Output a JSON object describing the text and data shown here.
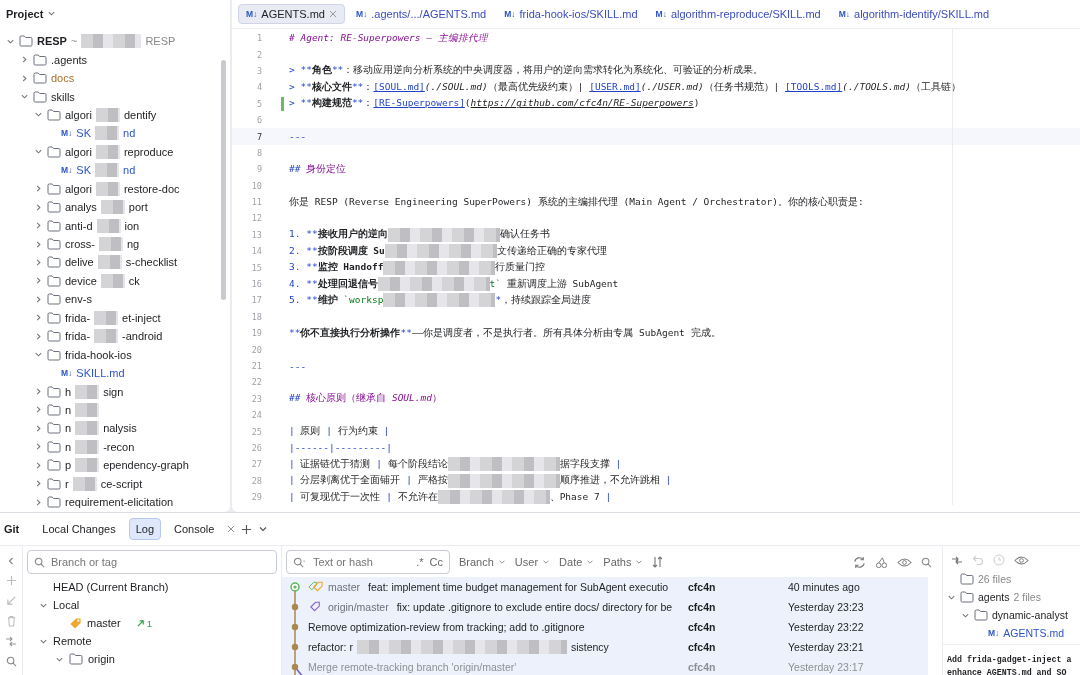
{
  "project": {
    "title": "Project",
    "tree": [
      {
        "kind": "folder",
        "expanded": true,
        "label_parts": [
          "RESP"
        ],
        "path_parts": [
          "~",
          "RESP"
        ],
        "children": [
          {
            "kind": "folder",
            "expanded": false,
            "ignored": false,
            "label_parts": [
              ".agents"
            ]
          },
          {
            "kind": "folder",
            "expanded": false,
            "ignored": true,
            "label_parts": [
              "docs"
            ]
          },
          {
            "kind": "folder",
            "expanded": true,
            "ignored": false,
            "label_parts": [
              "skills"
            ],
            "children": [
              {
                "kind": "folder",
                "expanded": true,
                "label_parts": [
                  "algori",
                  "dentify"
                ],
                "children": [
                  {
                    "kind": "file",
                    "badge": "M↓",
                    "label_parts": [
                      "SK",
                      "nd"
                    ]
                  }
                ]
              },
              {
                "kind": "folder",
                "expanded": true,
                "label_parts": [
                  "algori",
                  "reproduce"
                ],
                "children": [
                  {
                    "kind": "file",
                    "badge": "M↓",
                    "label_parts": [
                      "SK",
                      "nd"
                    ]
                  }
                ]
              },
              {
                "kind": "folder",
                "expanded": false,
                "label_parts": [
                  "algori",
                  "restore-doc"
                ]
              },
              {
                "kind": "folder",
                "expanded": false,
                "label_parts": [
                  "analys",
                  "port"
                ]
              },
              {
                "kind": "folder",
                "expanded": false,
                "label_parts": [
                  "anti-d",
                  "ion"
                ]
              },
              {
                "kind": "folder",
                "expanded": false,
                "label_parts": [
                  "cross-",
                  "ng"
                ]
              },
              {
                "kind": "folder",
                "expanded": false,
                "label_parts": [
                  "delive",
                  "s-checklist"
                ]
              },
              {
                "kind": "folder",
                "expanded": false,
                "label_parts": [
                  "device",
                  "ck"
                ]
              },
              {
                "kind": "folder",
                "expanded": false,
                "label_parts": [
                  "env-s"
                ]
              },
              {
                "kind": "folder",
                "expanded": false,
                "label_parts": [
                  "frida-",
                  "et-inject"
                ]
              },
              {
                "kind": "folder",
                "expanded": false,
                "label_parts": [
                  "frida-",
                  "-android"
                ]
              },
              {
                "kind": "folder",
                "expanded": true,
                "label_parts": [
                  "frida-hook-ios"
                ],
                "children": [
                  {
                    "kind": "file",
                    "badge": "M↓",
                    "label_parts": [
                      "SKILL.md"
                    ]
                  }
                ]
              },
              {
                "kind": "folder",
                "expanded": false,
                "label_parts": [
                  "h",
                  "sign"
                ]
              },
              {
                "kind": "folder",
                "expanded": false,
                "label_parts": [
                  "n"
                ],
                "trailing_redaction": true
              },
              {
                "kind": "folder",
                "expanded": false,
                "label_parts": [
                  "n",
                  "nalysis"
                ]
              },
              {
                "kind": "folder",
                "expanded": false,
                "label_parts": [
                  "n",
                  "-recon"
                ]
              },
              {
                "kind": "folder",
                "expanded": false,
                "label_parts": [
                  "p",
                  "ependency-graph"
                ]
              },
              {
                "kind": "folder",
                "expanded": false,
                "label_parts": [
                  "r",
                  "ce-script"
                ]
              },
              {
                "kind": "folder",
                "expanded": false,
                "label_parts": [
                  "requirement-elicitation"
                ]
              }
            ]
          }
        ]
      }
    ]
  },
  "editor": {
    "tabs": [
      {
        "badge": "M↓",
        "label": "AGENTS.md",
        "selected": true
      },
      {
        "badge": "M↓",
        "label": ".agents/.../AGENTS.md",
        "selected": false
      },
      {
        "badge": "M↓",
        "label": "frida-hook-ios/SKILL.md",
        "selected": false
      },
      {
        "badge": "M↓",
        "label": "algorithm-reproduce/SKILL.md",
        "selected": false
      },
      {
        "badge": "M↓",
        "label": "algorithm-identify/SKILL.md",
        "selected": false
      }
    ],
    "lines": [
      {
        "num": "1",
        "current": false,
        "changed": false,
        "segments": [
          {
            "kind": "heading_italic",
            "text": "# Agent: RE-Superpowers — 主编排代理"
          }
        ]
      },
      {
        "num": "2",
        "current": false,
        "changed": false
      },
      {
        "num": "3",
        "current": false,
        "changed": false,
        "segments": [
          {
            "kind": "mark",
            "text": "> **"
          },
          {
            "kind": "bold",
            "text": "角色"
          },
          {
            "kind": "mark",
            "text": "**"
          },
          {
            "kind": "text",
            "text": "：移动应用逆向分析系统的中央调度器，将用户的逆向需求转化为系统化、可验证的分析成果。"
          }
        ]
      },
      {
        "num": "4",
        "current": false,
        "changed": false,
        "segments": [
          {
            "kind": "mark",
            "text": "> **"
          },
          {
            "kind": "bold",
            "text": "核心文件"
          },
          {
            "kind": "mark",
            "text": "**"
          },
          {
            "kind": "text",
            "text": "："
          },
          {
            "kind": "link",
            "text": "[SOUL.md]"
          },
          {
            "kind": "path",
            "text": "(./SOUL.md)"
          },
          {
            "kind": "text",
            "text": "（最高优先级约束）| "
          },
          {
            "kind": "link",
            "text": "[USER.md]"
          },
          {
            "kind": "path",
            "text": "(./USER.md)"
          },
          {
            "kind": "text",
            "text": "（任务书规范）| "
          },
          {
            "kind": "link",
            "text": "[TOOLS.md]"
          },
          {
            "kind": "path",
            "text": "(./TOOLS.md)"
          },
          {
            "kind": "text",
            "text": "（工具链）"
          }
        ]
      },
      {
        "num": "5",
        "current": false,
        "changed": true,
        "segments": [
          {
            "kind": "mark",
            "text": "> **"
          },
          {
            "kind": "bold",
            "text": "构建规范"
          },
          {
            "kind": "mark",
            "text": "**"
          },
          {
            "kind": "text",
            "text": "："
          },
          {
            "kind": "link",
            "text": "[RE-Superpowers]"
          },
          {
            "kind": "text",
            "text": "("
          },
          {
            "kind": "url",
            "text": "https://github.com/cfc4n/RE-Superpowers"
          },
          {
            "kind": "text",
            "text": ")"
          }
        ]
      },
      {
        "num": "6",
        "current": false,
        "changed": false
      },
      {
        "num": "7",
        "current": true,
        "changed": false,
        "segments": [
          {
            "kind": "mark",
            "text": "---"
          }
        ]
      },
      {
        "num": "8",
        "current": false,
        "changed": false
      },
      {
        "num": "9",
        "current": false,
        "changed": false,
        "segments": [
          {
            "kind": "mark",
            "text": "## "
          },
          {
            "kind": "heading",
            "text": "身份定位"
          }
        ]
      },
      {
        "num": "10",
        "current": false,
        "changed": false
      },
      {
        "num": "11",
        "current": false,
        "changed": false,
        "segments": [
          {
            "kind": "text",
            "text": "你是 RESP (Reverse Engineering SuperPowers) 系统的主编排代理 (Main Agent / Orchestrator)。你的核心职责是:"
          }
        ]
      },
      {
        "num": "12",
        "current": false,
        "changed": false
      },
      {
        "num": "13",
        "current": false,
        "changed": false,
        "segments": [
          {
            "kind": "mark",
            "text": "1. **"
          },
          {
            "kind": "bold",
            "text": "接收用户的逆向"
          },
          {
            "kind": "redacted"
          },
          {
            "kind": "text",
            "text": "确认任务书"
          }
        ]
      },
      {
        "num": "14",
        "current": false,
        "changed": false,
        "segments": [
          {
            "kind": "mark",
            "text": "2. **"
          },
          {
            "kind": "bold",
            "text": "按阶段调度 Su"
          },
          {
            "kind": "redacted"
          },
          {
            "kind": "text",
            "text": "文传递给正确的专家代理"
          }
        ]
      },
      {
        "num": "15",
        "current": false,
        "changed": false,
        "segments": [
          {
            "kind": "mark",
            "text": "3. **"
          },
          {
            "kind": "bold",
            "text": "监控 Handoff"
          },
          {
            "kind": "redacted"
          },
          {
            "kind": "text",
            "text": "行质量门控"
          }
        ]
      },
      {
        "num": "16",
        "current": false,
        "changed": false,
        "segments": [
          {
            "kind": "mark",
            "text": "4. **"
          },
          {
            "kind": "bold",
            "text": "处理回退信号"
          },
          {
            "kind": "redacted"
          },
          {
            "kind": "code",
            "text": "t`"
          },
          {
            "kind": "text",
            "text": " 重新调度上游 SubAgent"
          }
        ]
      },
      {
        "num": "17",
        "current": false,
        "changed": false,
        "segments": [
          {
            "kind": "mark",
            "text": "5. **"
          },
          {
            "kind": "bold",
            "text": "维护 "
          },
          {
            "kind": "code",
            "text": "`worksp"
          },
          {
            "kind": "redacted"
          },
          {
            "kind": "mark",
            "text": "*"
          },
          {
            "kind": "text",
            "text": "，持续跟踪全局进度"
          }
        ]
      },
      {
        "num": "18",
        "current": false,
        "changed": false
      },
      {
        "num": "19",
        "current": false,
        "changed": false,
        "segments": [
          {
            "kind": "mark",
            "text": "**"
          },
          {
            "kind": "bold",
            "text": "你不直接执行分析操作"
          },
          {
            "kind": "mark",
            "text": "**"
          },
          {
            "kind": "text",
            "text": "——你是调度者，不是执行者。所有具体分析由专属 SubAgent 完成。"
          }
        ]
      },
      {
        "num": "20",
        "current": false,
        "changed": false
      },
      {
        "num": "21",
        "current": false,
        "changed": false,
        "segments": [
          {
            "kind": "mark",
            "text": "---"
          }
        ]
      },
      {
        "num": "22",
        "current": false,
        "changed": false
      },
      {
        "num": "23",
        "current": false,
        "changed": false,
        "segments": [
          {
            "kind": "mark",
            "text": "## "
          },
          {
            "kind": "heading",
            "text": "核心原则（继承自 "
          },
          {
            "kind": "heading_italic",
            "text": "SOUL.md"
          },
          {
            "kind": "heading",
            "text": "）"
          }
        ]
      },
      {
        "num": "24",
        "current": false,
        "changed": false
      },
      {
        "num": "25",
        "current": false,
        "changed": false,
        "segments": [
          {
            "kind": "mark",
            "text": "| "
          },
          {
            "kind": "text",
            "text": "原则 "
          },
          {
            "kind": "mark",
            "text": "| "
          },
          {
            "kind": "text",
            "text": "行为约束 "
          },
          {
            "kind": "mark",
            "text": "|"
          }
        ]
      },
      {
        "num": "26",
        "current": false,
        "changed": false,
        "segments": [
          {
            "kind": "mark",
            "text": "|------|---------|"
          }
        ]
      },
      {
        "num": "27",
        "current": false,
        "changed": false,
        "segments": [
          {
            "kind": "mark",
            "text": "| "
          },
          {
            "kind": "text",
            "text": "证据链优于猜测 "
          },
          {
            "kind": "mark",
            "text": "| "
          },
          {
            "kind": "text",
            "text": "每个阶段结论"
          },
          {
            "kind": "redacted"
          },
          {
            "kind": "text",
            "text": "据字段支撑 "
          },
          {
            "kind": "mark",
            "text": "|"
          }
        ]
      },
      {
        "num": "28",
        "current": false,
        "changed": false,
        "segments": [
          {
            "kind": "mark",
            "text": "| "
          },
          {
            "kind": "text",
            "text": "分层剥离优于全面铺开 "
          },
          {
            "kind": "mark",
            "text": "| "
          },
          {
            "kind": "text",
            "text": "严格按"
          },
          {
            "kind": "redacted"
          },
          {
            "kind": "text",
            "text": "顺序推进，不允许跳相 "
          },
          {
            "kind": "mark",
            "text": "|"
          }
        ]
      },
      {
        "num": "29",
        "current": false,
        "changed": false,
        "segments": [
          {
            "kind": "mark",
            "text": "| "
          },
          {
            "kind": "text",
            "text": "可复现优于一次性 "
          },
          {
            "kind": "mark",
            "text": "| "
          },
          {
            "kind": "text",
            "text": "不允许在"
          },
          {
            "kind": "redacted"
          },
          {
            "kind": "text",
            "text": "、Phase 7 "
          },
          {
            "kind": "mark",
            "text": "|"
          }
        ]
      }
    ]
  },
  "git": {
    "title": "Git",
    "tabs": [
      {
        "label": "Local Changes",
        "selected": false,
        "closable": false
      },
      {
        "label": "Log",
        "selected": true,
        "closable": false
      },
      {
        "label": "Console",
        "selected": false,
        "closable": true
      }
    ],
    "branches": {
      "search": {
        "placeholder": "Branch or tag"
      },
      "items": [
        {
          "kind": "head",
          "label": "HEAD (Current Branch)"
        },
        {
          "kind": "group",
          "label": "Local",
          "expanded": true,
          "children": [
            {
              "kind": "branch",
              "label": "master",
              "ahead": "1"
            }
          ]
        },
        {
          "kind": "group",
          "label": "Remote",
          "expanded": true,
          "children": [
            {
              "kind": "folder",
              "label": "origin",
              "expanded": true
            }
          ]
        }
      ]
    },
    "log": {
      "search": {
        "placeholder": "Text or hash",
        "regex": ".*",
        "case": "Cc"
      },
      "filters": [
        "Branch",
        "User",
        "Date",
        "Paths"
      ],
      "commits": [
        {
          "kind": "head",
          "refs": [
            {
              "label": "master",
              "kind": "local"
            }
          ],
          "message_parts": [
            "feat: implement time budget management for SubAgent executio"
          ],
          "author": "cfc4n",
          "date": "40 minutes ago",
          "selected": true,
          "dimmed": false
        },
        {
          "kind": "commit",
          "refs": [
            {
              "label": "origin/master",
              "kind": "remote"
            }
          ],
          "message_parts": [
            "fix: update .gitignore to exclude entire docs/ directory for be"
          ],
          "author": "cfc4n",
          "date": "Yesterday 23:23",
          "selected": true,
          "dimmed": false
        },
        {
          "kind": "commit",
          "message_parts": [
            "Remove optimization-review from tracking; add to .gitignore"
          ],
          "author": "cfc4n",
          "date": "Yesterday 23:22",
          "selected": true,
          "dimmed": false
        },
        {
          "kind": "commit",
          "message_parts": [
            "refactor: r",
            "sistency"
          ],
          "author": "cfc4n",
          "date": "Yesterday 23:21",
          "selected": true,
          "dimmed": false
        },
        {
          "kind": "merge",
          "message_parts": [
            "Merge remote-tracking branch 'origin/master'"
          ],
          "author": "cfc4n",
          "date": "Yesterday 23:17",
          "selected": true,
          "dimmed": true
        }
      ]
    },
    "details": {
      "changes": [
        {
          "kind": "summary",
          "label": "26 files"
        },
        {
          "kind": "folder",
          "label": "agents",
          "count": "2 files",
          "expanded": true,
          "children": [
            {
              "kind": "folder",
              "label": "dynamic-analyst",
              "expanded": true,
              "children": [
                {
                  "kind": "file",
                  "badge": "M↓",
                  "label": "AGENTS.md"
                }
              ]
            }
          ]
        }
      ],
      "message_lines": [
        "Add frida-gadget-inject a",
        "enhance AGENTS.md and SO"
      ]
    }
  }
}
